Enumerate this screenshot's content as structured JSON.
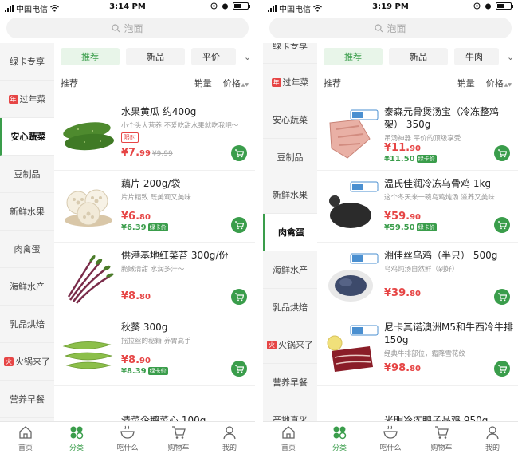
{
  "left": {
    "status": {
      "carrier": "中国电信",
      "time": "3:14 PM"
    },
    "search_placeholder": "泡面",
    "categories": [
      "绿卡专享",
      "过年菜",
      "安心蔬菜",
      "豆制品",
      "新鲜水果",
      "肉禽蛋",
      "海鲜水产",
      "乳品烘焙",
      "火锅来了",
      "营养早餐"
    ],
    "cat_tag": {
      "1": "年",
      "8": "火"
    },
    "filters": [
      "推荐",
      "新品",
      "平价"
    ],
    "sort": {
      "label": "推荐",
      "sales": "销量",
      "price": "价格"
    },
    "products": [
      {
        "name": "水果黄瓜 约400g",
        "desc": "小个头大营养 不爱吃甜水果就吃我吧～",
        "badge": "限时",
        "price": "¥7.",
        "price_small": "99",
        "orig": "¥9.99"
      },
      {
        "name": "藕片 200g/袋",
        "desc": "片片精致 既美观又美味",
        "price": "¥6.",
        "price_small": "80",
        "vip": "¥6.39",
        "vip_tag": "绿卡价"
      },
      {
        "name": "供港基地红菜苔 300g/份",
        "desc": "脆嫩清甜 水润多汁～",
        "price": "¥8.",
        "price_small": "80"
      },
      {
        "name": "秋葵 300g",
        "desc": "摇拉丝的秘籍 养胃高手",
        "price": "¥8.",
        "price_small": "90",
        "vip": "¥8.39",
        "vip_tag": "绿卡价"
      }
    ],
    "peek": "清菜企鹅菜心 100g",
    "tabs": [
      "首页",
      "分类",
      "吃什么",
      "购物车",
      "我的"
    ]
  },
  "right": {
    "status": {
      "carrier": "中国电信",
      "time": "3:19 PM"
    },
    "search_placeholder": "泡面",
    "top_cat_partial": "绿卡专享",
    "categories": [
      "过年菜",
      "安心蔬菜",
      "豆制品",
      "新鲜水果",
      "肉禽蛋",
      "海鲜水产",
      "乳品烘焙",
      "火锅来了",
      "营养早餐",
      "产地直采"
    ],
    "cat_tag": {
      "0": "年",
      "7": "火"
    },
    "filters": [
      "推荐",
      "新品",
      "牛肉"
    ],
    "sort": {
      "label": "推荐",
      "sales": "销量",
      "price": "价格"
    },
    "products": [
      {
        "name": "泰森元骨煲汤宝（冷冻整鸡架） 350g",
        "desc": "吊汤神器 平价的顶级享受",
        "price": "¥11.",
        "price_small": "90",
        "vip": "¥11.50",
        "vip_tag": "绿卡价",
        "frozen": "冷冻"
      },
      {
        "name": "温氏佳润冷冻乌骨鸡 1kg",
        "desc": "这个冬天来一碗乌鸡炖汤 滋养又美味",
        "price": "¥59.",
        "price_small": "90",
        "vip": "¥59.50",
        "vip_tag": "绿卡价",
        "frozen": "冷冻"
      },
      {
        "name": "湘佳丝乌鸡（半只） 500g",
        "desc": "乌鸡炖汤自然鲜（剁好）",
        "price": "¥39.",
        "price_small": "80",
        "frozen": "冷冻"
      },
      {
        "name": "尼卡其诺澳洲M5和牛西冷牛排 150g",
        "desc": "经典牛排部位，霜降雪花纹",
        "price": "¥98.",
        "price_small": "80",
        "frozen": "冷冻"
      }
    ],
    "peek": "米明冷冻鸭子品鸡 950g",
    "tabs": [
      "首页",
      "分类",
      "吃什么",
      "购物车",
      "我的"
    ]
  },
  "colors": {
    "accent": "#3a9d4b",
    "price": "#e64545"
  },
  "icons": [
    "search-icon",
    "cart-plus-icon",
    "home-icon",
    "category-icon",
    "bowl-icon",
    "shopping-cart-icon",
    "profile-icon"
  ]
}
